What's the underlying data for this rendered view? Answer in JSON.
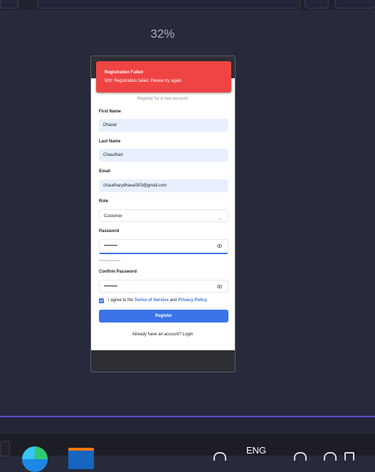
{
  "viewer": {
    "zoom": "32%"
  },
  "toast": {
    "title": "Registration Failed",
    "message": "500: Registration failed. Please try again."
  },
  "form": {
    "subtitle": "Register for a new account",
    "first_name": {
      "label": "First Name",
      "value": "Dhaval"
    },
    "last_name": {
      "label": "Last Name",
      "value": "Chaudhari"
    },
    "email": {
      "label": "Email",
      "value": "chaudharydhaval303@gmail.com"
    },
    "role": {
      "label": "Role",
      "value": "Customer"
    },
    "password": {
      "label": "Password",
      "value": "•••••••••",
      "hint": "Strong password"
    },
    "confirm_password": {
      "label": "Confirm Password",
      "value": "•••••••••"
    },
    "agree": {
      "prefix": "I agree to the",
      "terms": "Terms of Service",
      "and": "and",
      "privacy": "Privacy Policy"
    },
    "register_label": "Register",
    "login_prompt": "Already have an account? Login"
  },
  "taskbar": {
    "language": "ENG"
  },
  "colors": {
    "primary": "#3b73e8",
    "error": "#ef4444",
    "input_fill": "#e8f0fe"
  }
}
